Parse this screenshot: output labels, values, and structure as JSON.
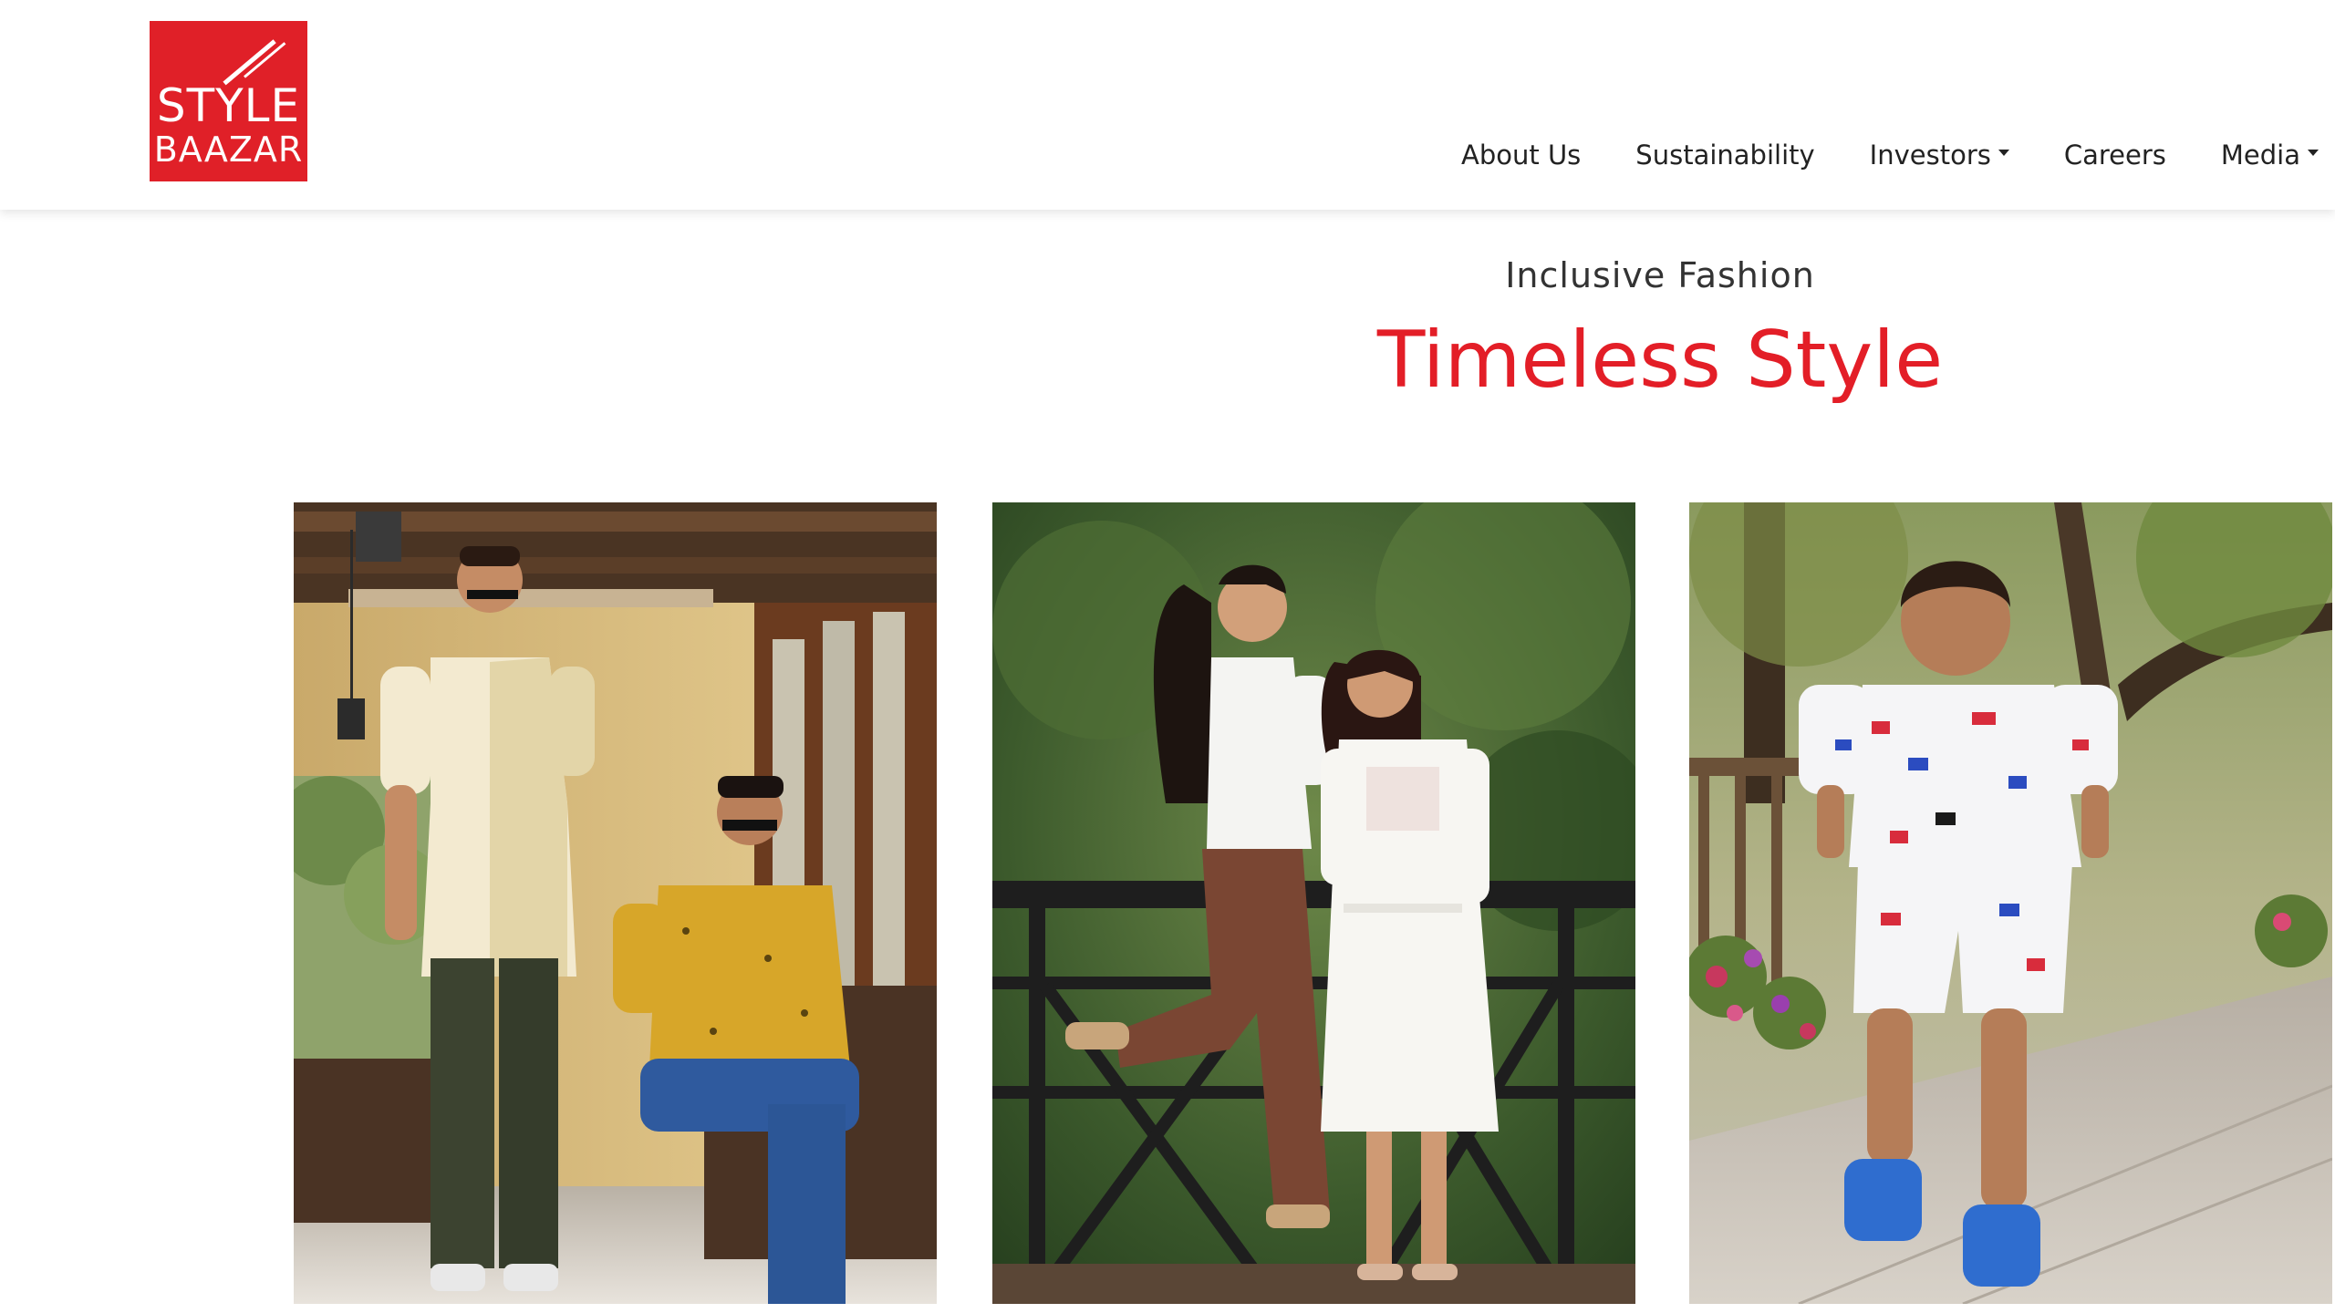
{
  "brand": {
    "logo_line1": "STYLE",
    "logo_line2": "BAAZAR",
    "color": "#e02028"
  },
  "nav": {
    "items": [
      {
        "label": "About Us",
        "dropdown": false
      },
      {
        "label": "Sustainability",
        "dropdown": false
      },
      {
        "label": "Investors",
        "dropdown": true
      },
      {
        "label": "Careers",
        "dropdown": false
      },
      {
        "label": "Media",
        "dropdown": true
      }
    ]
  },
  "hero": {
    "subtitle": "Inclusive Fashion",
    "title": "Timeless Style",
    "title_color": "#e31e27"
  },
  "cards": [
    {
      "subject": "men-fashion-photo"
    },
    {
      "subject": "women-fashion-photo"
    },
    {
      "subject": "kids-fashion-photo"
    }
  ]
}
